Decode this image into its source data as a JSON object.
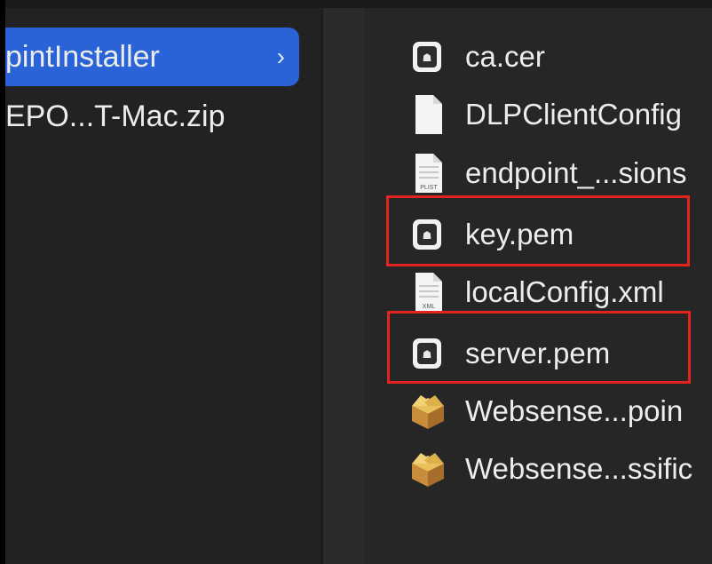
{
  "sidebar": {
    "items": [
      {
        "label": "pintInstaller",
        "selected": true,
        "chevron": "›"
      },
      {
        "label": "EPO...T-Mac.zip",
        "selected": false
      }
    ]
  },
  "files": [
    {
      "name": "ca.cer",
      "icon": "certificate-icon"
    },
    {
      "name": "DLPClientConfig",
      "icon": "blank-document-icon"
    },
    {
      "name": "endpoint_...sions",
      "icon": "plist-document-icon",
      "icon_label": "PLIST"
    },
    {
      "name": "key.pem",
      "icon": "certificate-icon",
      "highlighted": true
    },
    {
      "name": "localConfig.xml",
      "icon": "xml-document-icon",
      "icon_label": "XML"
    },
    {
      "name": "server.pem",
      "icon": "certificate-icon",
      "highlighted": true
    },
    {
      "name": "Websense...poin",
      "icon": "package-icon"
    },
    {
      "name": "Websense...ssific",
      "icon": "package-icon"
    }
  ],
  "colors": {
    "selection": "#2a63d8",
    "highlight": "#e3231f",
    "text": "#ececec"
  }
}
